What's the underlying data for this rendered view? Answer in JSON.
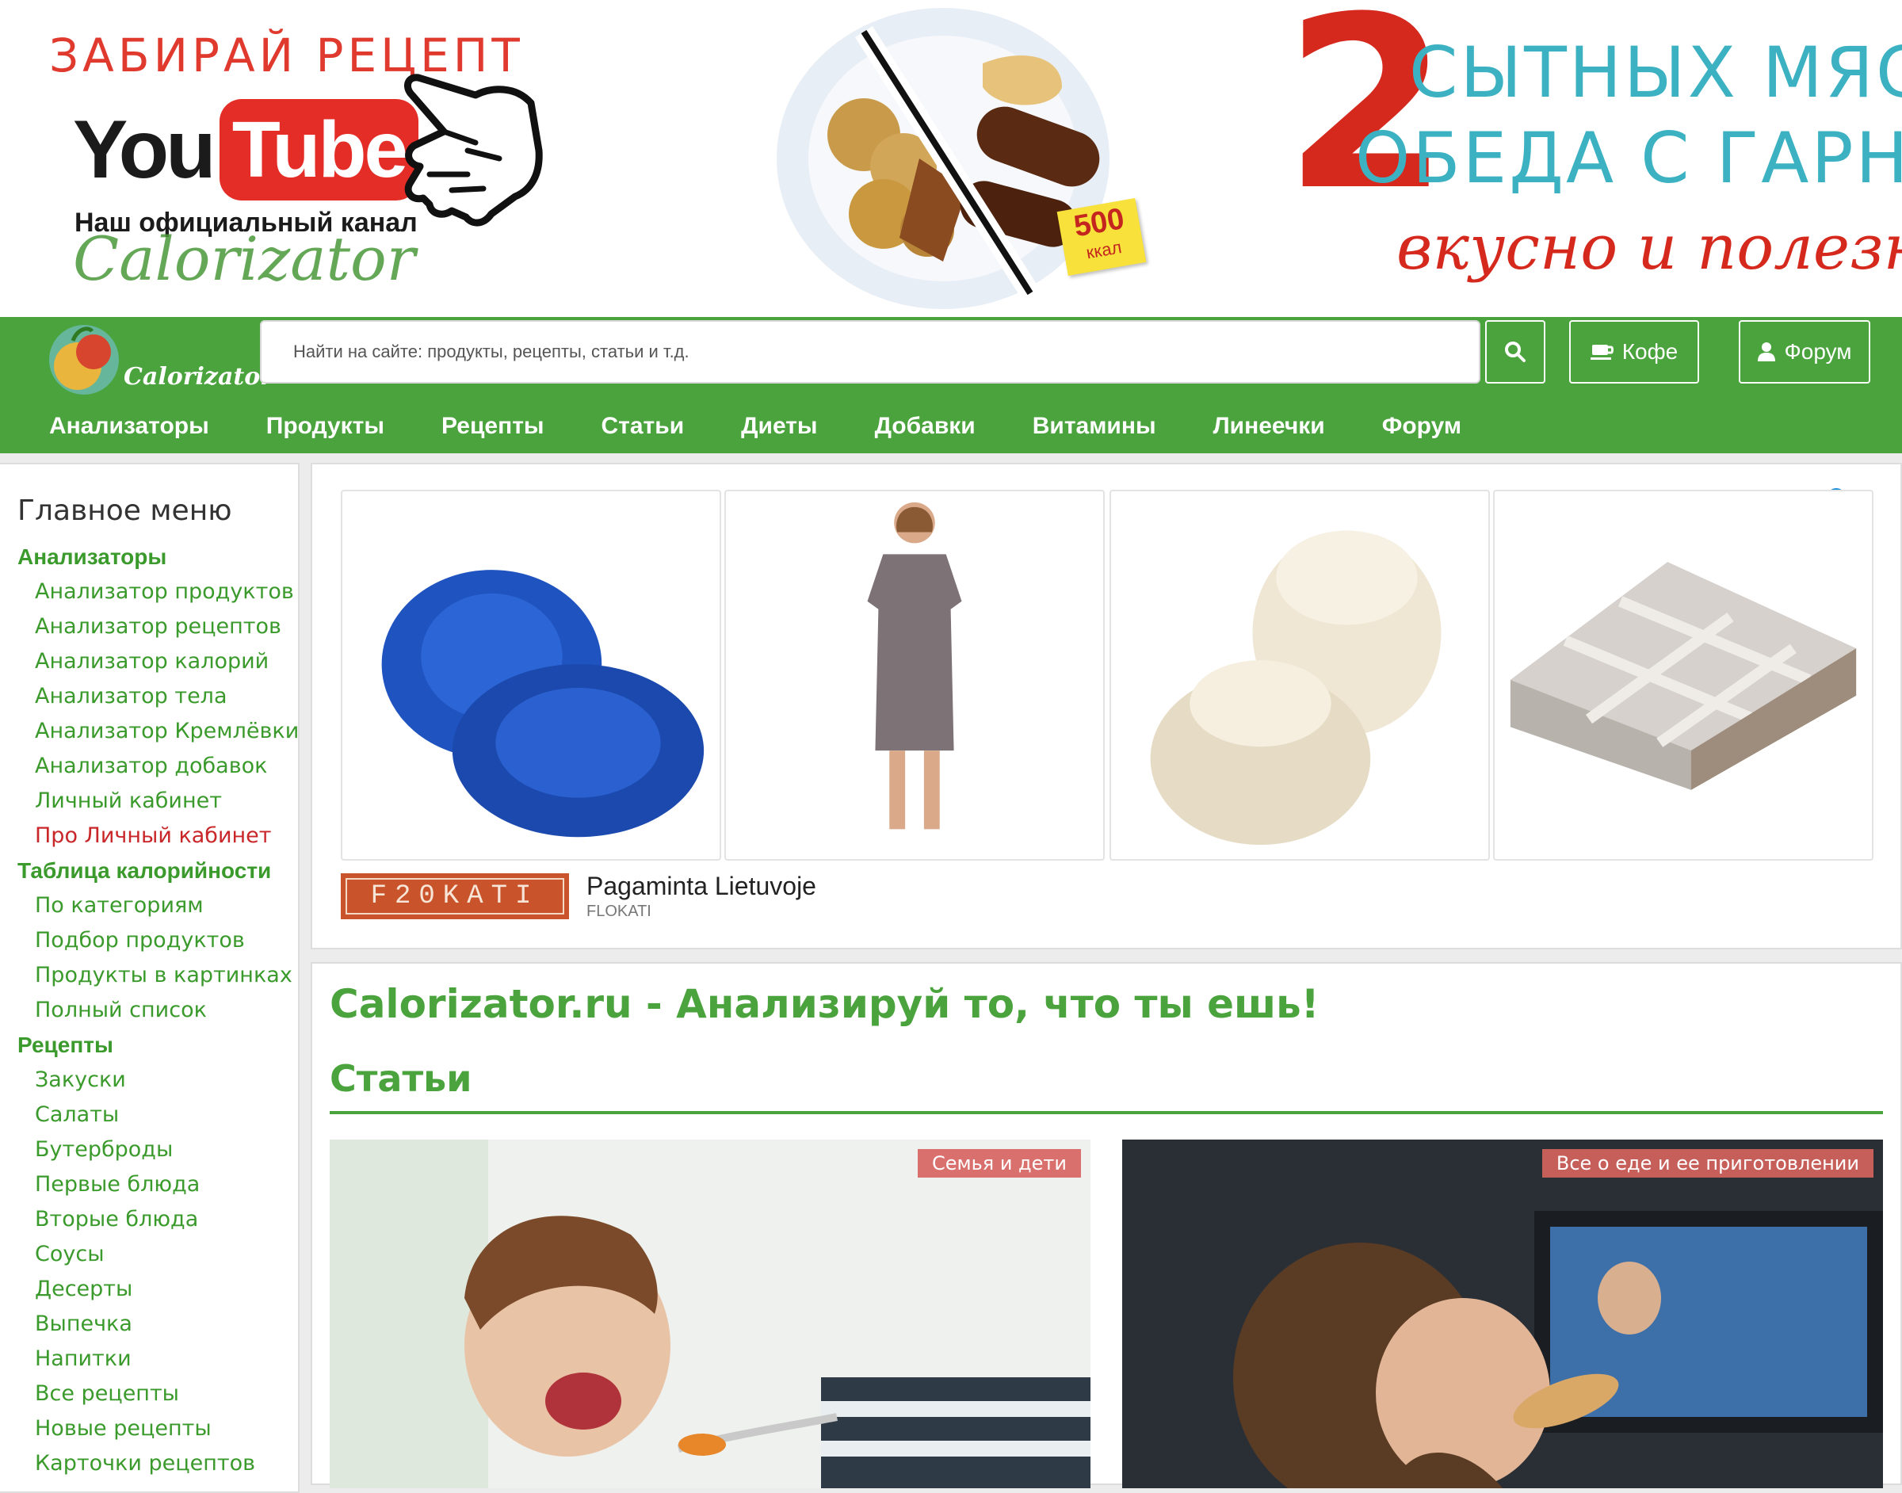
{
  "banner": {
    "cta": "ЗАБИРАЙ РЕЦЕПТ",
    "yt_you": "You",
    "yt_tube": "Tube",
    "channel": "Наш официальный канал",
    "brand_script": "Calorizator",
    "sticker_num": "500",
    "sticker_unit": "ккал",
    "big_number": "2",
    "promo_line1": "СЫТНЫХ МЯСНЫХ",
    "promo_line2": "ОБЕДА С ГАРНИРОМ",
    "promo_line3": "вкусно и полезно"
  },
  "header": {
    "logo_text": "Calorizator",
    "search_placeholder": "Найти на сайте: продукты, рецепты, статьи и т.д.",
    "coffee_label": "Кофе",
    "forum_label": "Форум",
    "nav": [
      "Анализаторы",
      "Продукты",
      "Рецепты",
      "Статьи",
      "Диеты",
      "Добавки",
      "Витамины",
      "Линеечки",
      "Форум"
    ]
  },
  "sidebar": {
    "title": "Главное меню",
    "groups": [
      {
        "heading": "Анализаторы",
        "links": [
          "Анализатор продуктов",
          "Анализатор рецептов",
          "Анализатор калорий",
          "Анализатор тела",
          "Анализатор Кремлёвки",
          "Анализатор добавок",
          "Личный кабинет",
          "Про Личный кабинет"
        ]
      },
      {
        "heading": "Таблица калорийности",
        "links": [
          "По категориям",
          "Подбор продуктов",
          "Продукты в картинках",
          "Полный список"
        ]
      },
      {
        "heading": "Рецепты",
        "links": [
          "Закуски",
          "Салаты",
          "Бутерброды",
          "Первые блюда",
          "Вторые блюда",
          "Соусы",
          "Десерты",
          "Выпечка",
          "Напитки",
          "Все рецепты",
          "Новые рецепты",
          "Карточки рецептов"
        ]
      }
    ]
  },
  "ad": {
    "logo_text": "F20KATI",
    "title": "Pagaminta Lietuvoje",
    "sponsor": "FLOKATI",
    "info_symbol": "i",
    "close_symbol": "✕"
  },
  "main": {
    "page_title": "Calorizator.ru - Анализируй то, что ты ешь!",
    "section_title": "Статьи",
    "cards": [
      {
        "badge": "Семья и дети"
      },
      {
        "badge": "Все о еде и ее приготовлении"
      }
    ]
  },
  "colors": {
    "brand_green": "#4aa33c",
    "link_green": "#3b9a2c",
    "link_red": "#c9262a",
    "badge_red": "#d9706d"
  },
  "icons": {
    "search": "search-icon",
    "coffee": "coffee-icon",
    "forum": "user-icon",
    "hand": "pointing-hand-icon"
  }
}
